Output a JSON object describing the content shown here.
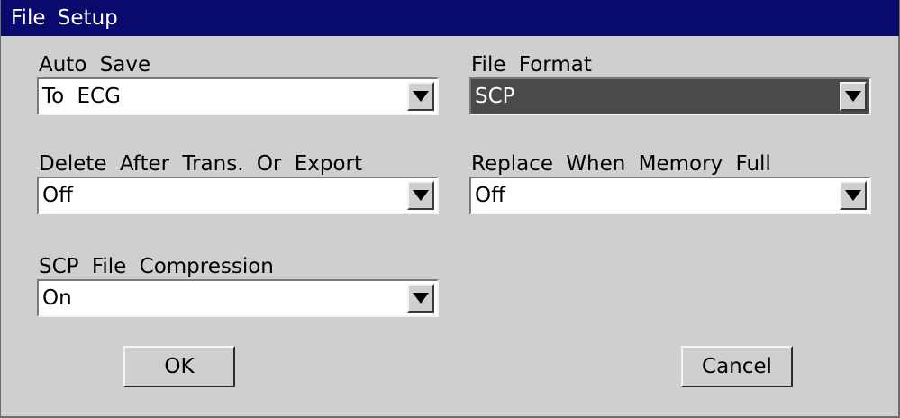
{
  "dialog": {
    "title": "File Setup"
  },
  "fields": {
    "auto_save": {
      "label": "Auto Save",
      "value": "To ECG"
    },
    "file_format": {
      "label": "File Format",
      "value": "SCP"
    },
    "delete_after": {
      "label": "Delete After Trans. Or Export",
      "value": "Off"
    },
    "replace_when_full": {
      "label": "Replace When Memory Full",
      "value": "Off"
    },
    "scp_compression": {
      "label": "SCP File Compression",
      "value": "On"
    }
  },
  "buttons": {
    "ok": "OK",
    "cancel": "Cancel"
  },
  "colors": {
    "title_bar": "#0a0a6e",
    "dialog_bg": "#cfcfcf",
    "selected_field": "#4a4a4a"
  },
  "icons": {
    "dropdown": "triangle-down-icon"
  }
}
